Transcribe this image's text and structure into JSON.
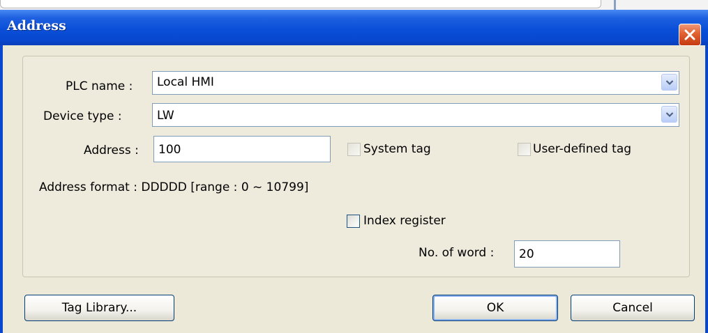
{
  "dialog": {
    "title": "Address"
  },
  "form": {
    "plc_name_label": "PLC name :",
    "plc_name_value": "Local HMI",
    "device_type_label": "Device type :",
    "device_type_value": "LW",
    "address_label": "Address :",
    "address_value": "100",
    "system_tag_label": "System tag",
    "system_tag_checked": false,
    "user_defined_tag_label": "User-defined tag",
    "user_defined_tag_checked": false,
    "address_format_text": "Address format : DDDDD [range : 0 ~ 10799]",
    "index_register_label": "Index register",
    "index_register_checked": false,
    "no_of_word_label": "No. of word :",
    "no_of_word_value": "20"
  },
  "buttons": {
    "tag_library": "Tag Library...",
    "ok": "OK",
    "cancel": "Cancel"
  },
  "icons": {
    "close": "close-icon",
    "dropdown": "chevron-down-icon"
  },
  "colors": {
    "titlebar": "#0a4fd8",
    "close_button": "#e06030",
    "dialog_background": "#ece9d8",
    "button_border": "#003c74"
  }
}
